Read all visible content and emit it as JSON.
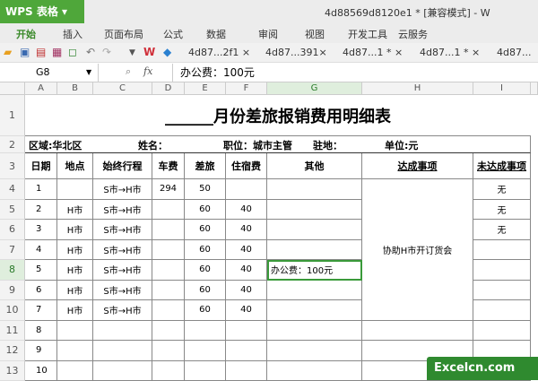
{
  "app": {
    "logo": "WPS 表格",
    "doc_title": "4d88569d8120e1 * [兼容模式] - W"
  },
  "menu": [
    "开始",
    "插入",
    "页面布局",
    "公式",
    "数据",
    "审阅",
    "视图",
    "开发工具",
    "云服务"
  ],
  "tabs": [
    "4d87...2f1 ×",
    "4d87...391×",
    "4d87...1 * ×",
    "4d87...1 * ×",
    "4d87..."
  ],
  "formula_bar": {
    "cell_ref": "G8",
    "fx": "fx",
    "content": "办公费：100元"
  },
  "columns": [
    "A",
    "B",
    "C",
    "D",
    "E",
    "F",
    "G",
    "H",
    "I"
  ],
  "rows": [
    "1",
    "2",
    "3",
    "4",
    "5",
    "6",
    "7",
    "8",
    "9",
    "10",
    "11",
    "12",
    "13"
  ],
  "sheet": {
    "title": "______月份差旅报销费用明细表",
    "info": {
      "region": "区域:华北区",
      "name": "姓名：",
      "position": "职位：城市主管",
      "station": "驻地：",
      "unit": "单位:元"
    },
    "headers": [
      "日期",
      "地点",
      "始终行程",
      "车费",
      "差旅",
      "住宿费",
      "其他",
      "达成事项",
      "未达成事项"
    ],
    "data": [
      [
        "1",
        "",
        "S市→H市",
        "294",
        "50",
        "",
        "",
        "",
        ""
      ],
      [
        "2",
        "H市",
        "S市→H市",
        "",
        "60",
        "40",
        "",
        "",
        ""
      ],
      [
        "3",
        "H市",
        "S市→H市",
        "",
        "60",
        "40",
        "",
        "",
        ""
      ],
      [
        "4",
        "H市",
        "S市→H市",
        "",
        "60",
        "40",
        "",
        "",
        ""
      ],
      [
        "5",
        "H市",
        "S市→H市",
        "",
        "60",
        "40",
        "办公费：100元",
        "",
        ""
      ],
      [
        "6",
        "H市",
        "S市→H市",
        "",
        "60",
        "40",
        "",
        "",
        ""
      ],
      [
        "7",
        "H市",
        "S市→H市",
        "",
        "60",
        "40",
        "",
        "",
        ""
      ],
      [
        "8",
        "",
        "",
        "",
        "",
        "",
        "",
        "",
        ""
      ],
      [
        "9",
        "",
        "",
        "",
        "",
        "",
        "",
        "",
        ""
      ],
      [
        "10",
        "",
        "",
        "",
        "",
        "",
        "",
        "",
        ""
      ]
    ],
    "achieved": "协助H市开订货会",
    "not_achieved": [
      "无",
      "无",
      "无"
    ]
  },
  "watermark": "Excelcn.com"
}
